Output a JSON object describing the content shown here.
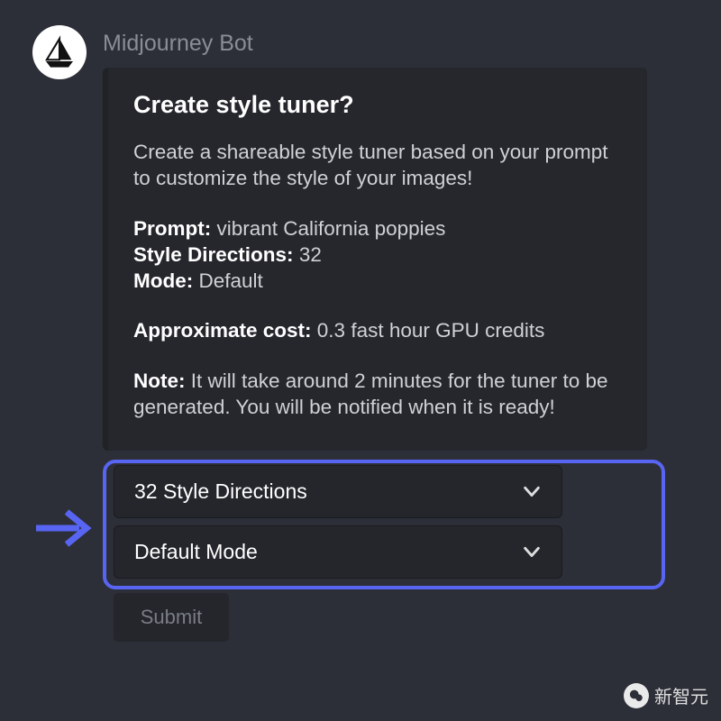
{
  "bot_name": "Midjourney Bot",
  "embed": {
    "title": "Create style tuner?",
    "intro": "Create a shareable style tuner based on your prompt to customize the style of your images!",
    "fields": {
      "prompt_label": "Prompt:",
      "prompt_value": "vibrant California poppies",
      "style_dir_label": "Style Directions:",
      "style_dir_value": "32",
      "mode_label": "Mode:",
      "mode_value": "Default",
      "cost_label": "Approximate cost:",
      "cost_value": "0.3 fast hour GPU credits",
      "note_label": "Note:",
      "note_value": "It will take around 2 minutes for the tuner to be generated. You will be notified when it is ready!"
    }
  },
  "controls": {
    "select_style_directions": "32 Style Directions",
    "select_mode": "Default Mode",
    "submit_label": "Submit"
  },
  "watermark_text": "新智元",
  "icons": {
    "avatar": "sailboat-icon",
    "chevron": "chevron-down-icon",
    "arrow": "arrow-right-icon",
    "wm": "wechat-icon"
  }
}
